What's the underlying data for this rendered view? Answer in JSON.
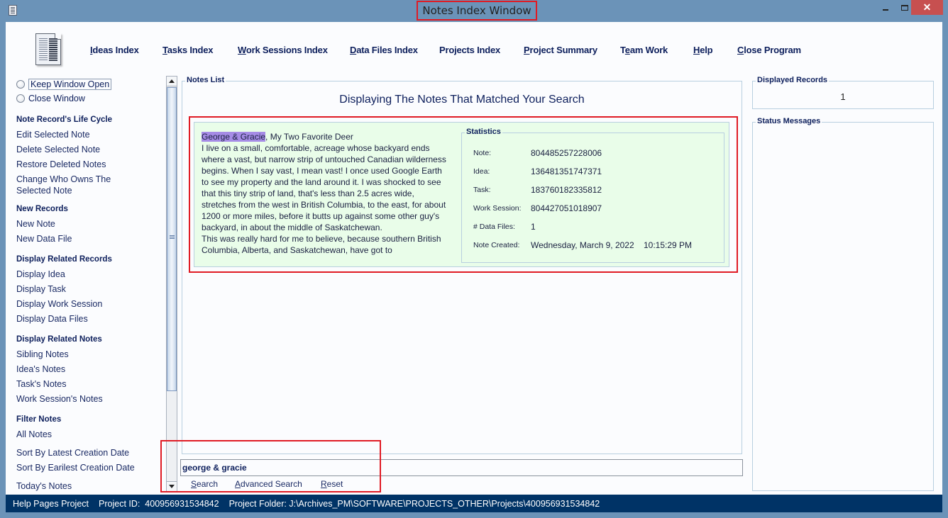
{
  "window": {
    "title": "Notes Index Window",
    "controls": {
      "minimize": "",
      "maximize": "",
      "close": "✕"
    }
  },
  "menu": [
    {
      "label_u": "I",
      "label_rest": "deas Index"
    },
    {
      "label_u": "T",
      "label_rest": "asks Index"
    },
    {
      "label_u": "W",
      "label_rest": "ork Sessions Index"
    },
    {
      "label_u": "D",
      "label_rest": "ata Files Index"
    },
    {
      "label_u": "",
      "label_rest": "Projects Index"
    },
    {
      "label_u": "P",
      "label_rest": "roject Summary"
    },
    {
      "label_pre": "T",
      "label_u": "e",
      "label_rest": "am Work"
    },
    {
      "label_u": "H",
      "label_rest": "elp"
    },
    {
      "label_u": "C",
      "label_rest": "lose Program"
    }
  ],
  "sidebar": {
    "radios": [
      {
        "label": "Keep Window Open",
        "selected": false
      },
      {
        "label": "Close Window",
        "selected": false
      }
    ],
    "sections": [
      {
        "heading": "Note Record's Life Cycle",
        "items": [
          "Edit Selected Note",
          "Delete Selected Note",
          "Restore Deleted Notes",
          "Change Who Owns The Selected Note"
        ]
      },
      {
        "heading": "New Records",
        "items": [
          "New Note",
          "New Data File"
        ]
      },
      {
        "heading": "Display Related Records",
        "items": [
          "Display Idea",
          "Display Task",
          "Display Work Session",
          "Display Data Files"
        ]
      },
      {
        "heading": "Display Related Notes",
        "items": [
          "Sibling Notes",
          "Idea's Notes",
          "Task's Notes",
          "Work Session's Notes"
        ]
      },
      {
        "heading": "Filter Notes",
        "items": [
          "All Notes",
          "Sort By Latest Creation Date",
          "Sort By Earilest Creation Date",
          "Today's Notes"
        ]
      }
    ]
  },
  "notes_list": {
    "legend": "Notes List",
    "heading": "Displaying The Notes That Matched Your Search",
    "note": {
      "highlight": "George & Gracie",
      "title_rest": ", My Two Favorite Deer",
      "body": "I live on a small, comfortable, acreage whose backyard ends where a vast, but narrow strip of untouched Canadian wilderness begins. When I say vast, I mean vast! I once used Google Earth to see my property and the land around it. I was shocked to see that this tiny strip of land, that's less than 2.5 acres wide, stretches from the west in British Columbia, to the east, for about 1200 or more miles, before it butts up against some other guy's backyard, in about the middle of Saskatchewan.",
      "body2": "This was really hard for me to believe, because southern British Columbia, Alberta, and Saskatchewan, have got to",
      "statistics": {
        "legend": "Statistics",
        "rows": [
          {
            "label": "Note:",
            "value": "804485257228006"
          },
          {
            "label": "Idea:",
            "value": "136481351747371"
          },
          {
            "label": "Task:",
            "value": "183760182335812"
          },
          {
            "label": "Work Session:",
            "value": "804427051018907"
          },
          {
            "label": "# Data Files:",
            "value": "1"
          },
          {
            "label": "Note Created:",
            "value": "Wednesday, March 9, 2022    10:15:29 PM"
          }
        ]
      }
    }
  },
  "search": {
    "value": "george & gracie",
    "buttons": [
      {
        "u": "S",
        "rest": "earch"
      },
      {
        "u": "A",
        "rest": "dvanced Search"
      },
      {
        "u": "R",
        "rest": "eset"
      }
    ]
  },
  "right_panel": {
    "displayed_records_legend": "Displayed Records",
    "displayed_records_count": "1",
    "status_messages_legend": "Status Messages"
  },
  "statusbar": {
    "project": "Help Pages Project",
    "project_id": "Project ID:  400956931534842",
    "project_folder": "Project Folder: J:\\Archives_PM\\SOFTWARE\\PROJECTS_OTHER\\Projects\\400956931534842"
  },
  "colors": {
    "titlebar": "#6b93b8",
    "accent_text": "#0d1f5c",
    "note_bg": "#e9fde9",
    "highlight": "#a68ce6",
    "statusbar": "#003366",
    "annotation_red": "#e01b24"
  }
}
